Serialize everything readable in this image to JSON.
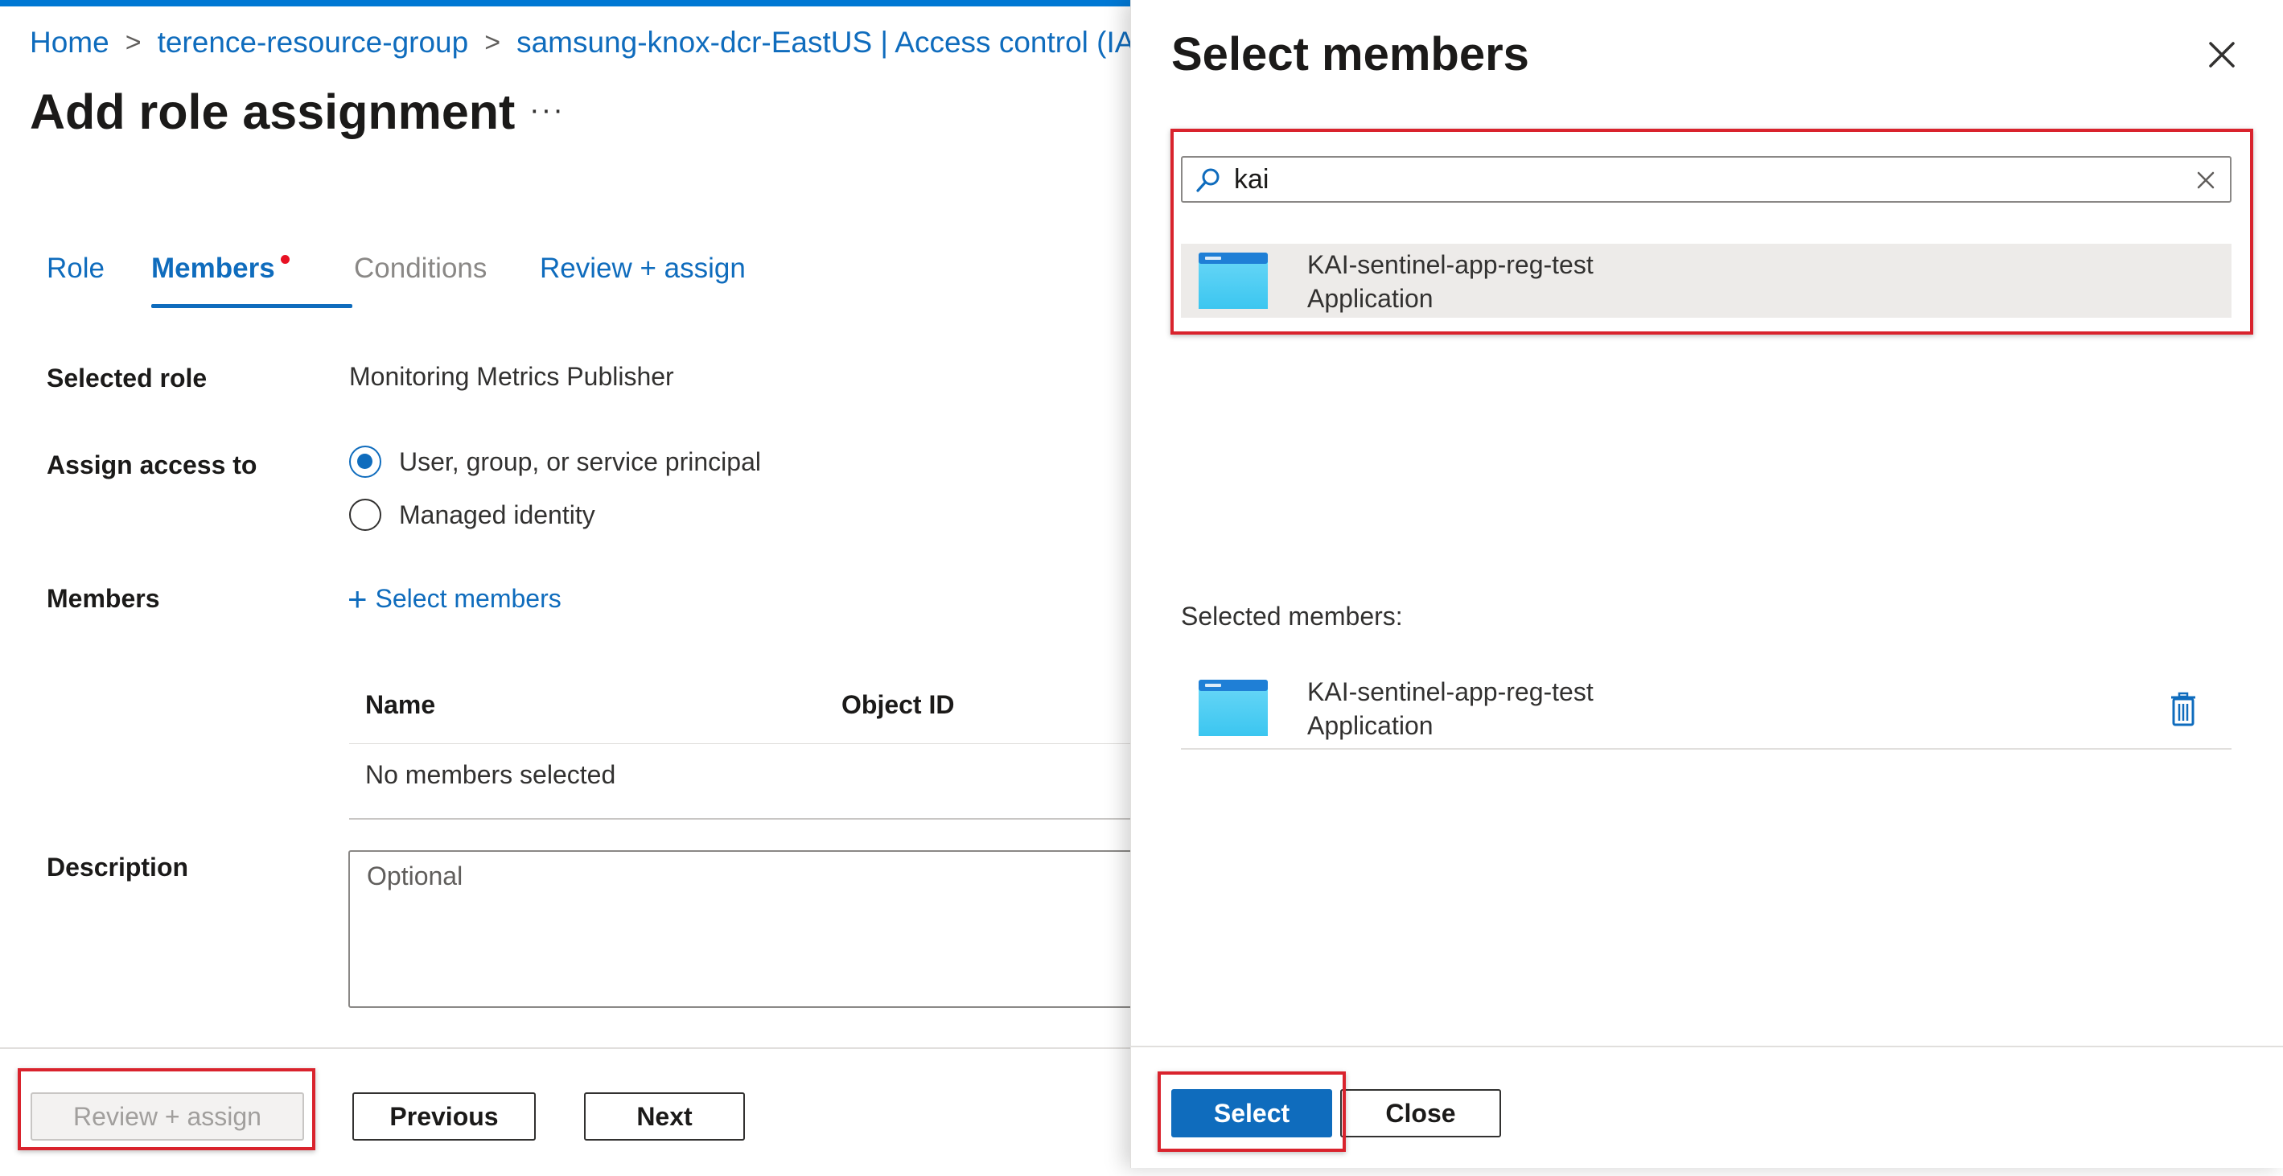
{
  "breadcrumb": {
    "items": [
      "Home",
      "terence-resource-group",
      "samsung-knox-dcr-EastUS | Access control (IAM)"
    ],
    "separator": ">"
  },
  "page": {
    "title": "Add role assignment",
    "more_label": "···"
  },
  "tabs": [
    {
      "label": "Role",
      "state": "link"
    },
    {
      "label": "Members",
      "state": "active"
    },
    {
      "label": "Conditions",
      "state": "disabled"
    },
    {
      "label": "Review + assign",
      "state": "link"
    }
  ],
  "form": {
    "selected_role_label": "Selected role",
    "selected_role_value": "Monitoring Metrics Publisher",
    "assign_access_label": "Assign access to",
    "assign_options": [
      {
        "label": "User, group, or service principal",
        "checked": true
      },
      {
        "label": "Managed identity",
        "checked": false
      }
    ],
    "members_label": "Members",
    "select_members_link": "Select members",
    "table": {
      "columns": [
        "Name",
        "Object ID"
      ],
      "empty_text": "No members selected"
    },
    "description_label": "Description",
    "description_placeholder": "Optional"
  },
  "footer": {
    "review_assign": "Review + assign",
    "previous": "Previous",
    "next": "Next"
  },
  "panel": {
    "title": "Select members",
    "search_value": "kai",
    "results": [
      {
        "name": "KAI-sentinel-app-reg-test",
        "type": "Application"
      }
    ],
    "selected_members_label": "Selected members:",
    "selected": [
      {
        "name": "KAI-sentinel-app-reg-test",
        "type": "Application"
      }
    ],
    "select_button": "Select",
    "close_button": "Close"
  },
  "colors": {
    "accent": "#0f6cbd",
    "highlight": "#d9232d",
    "top_bar": "#0078d4",
    "required_dot": "#e81123"
  },
  "icons": [
    "chevron-right-icon",
    "more-icon",
    "plus-icon",
    "close-icon",
    "search-icon",
    "clear-icon",
    "app-registration-icon",
    "trash-icon"
  ]
}
